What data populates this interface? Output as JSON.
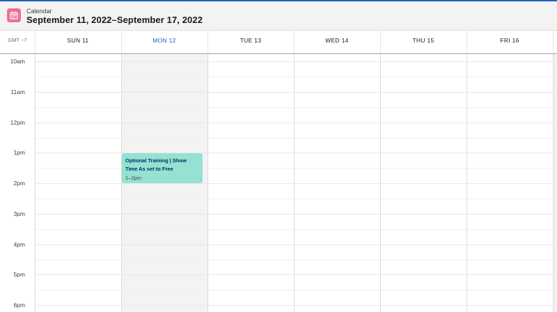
{
  "header": {
    "app_name": "Calendar",
    "range_title": "September 11, 2022–September 17, 2022",
    "icon": "calendar-icon",
    "icon_color": "#eb7092"
  },
  "day_header": {
    "timezone": "GMT −7",
    "days": [
      {
        "label": "SUN 11",
        "today": false
      },
      {
        "label": "MON 12",
        "today": true
      },
      {
        "label": "TUE 13",
        "today": false
      },
      {
        "label": "WED 14",
        "today": false
      },
      {
        "label": "THU 15",
        "today": false
      },
      {
        "label": "FRI 16",
        "today": false
      }
    ]
  },
  "time_labels": [
    "10am",
    "11am",
    "12pm",
    "1pm",
    "2pm",
    "3pm",
    "4pm",
    "5pm",
    "6pm"
  ],
  "event": {
    "title": "Optional Training | Show Time As set to Free",
    "time": "1–2pm",
    "day": "MON 12",
    "color": "#95e1d3"
  },
  "colors": {
    "today": "#1b5fc1",
    "header_bg": "#f3f3f3"
  }
}
